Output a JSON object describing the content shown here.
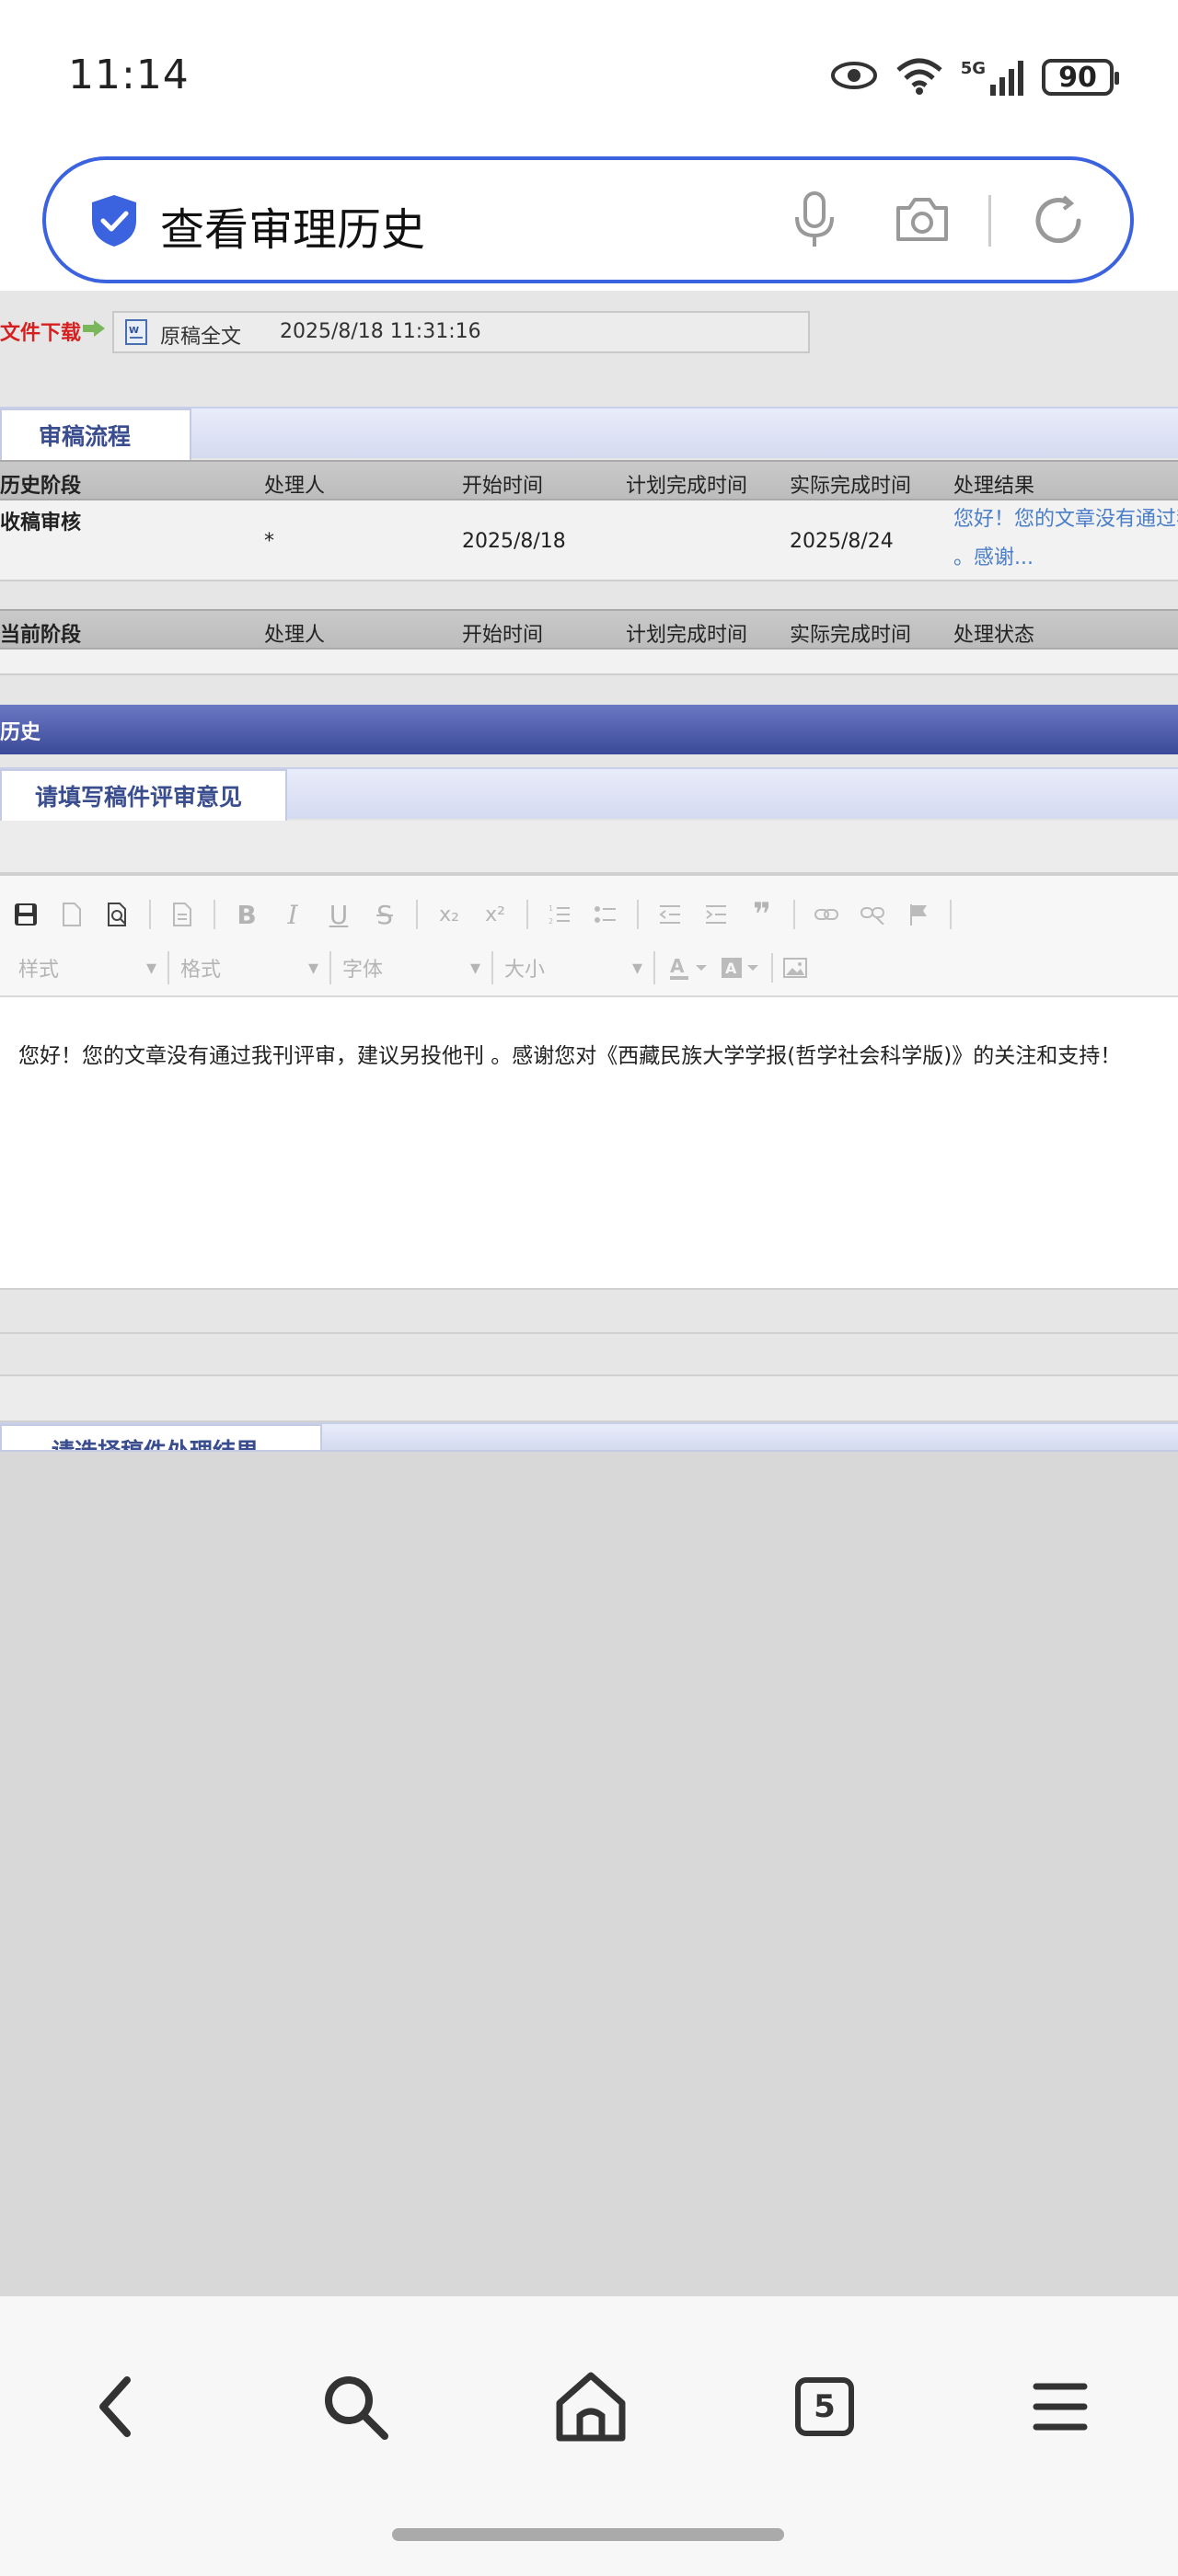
{
  "status_bar": {
    "time": "11:14",
    "battery": "90",
    "network": "5G"
  },
  "search": {
    "query": "查看审理历史"
  },
  "download": {
    "label": "文件下载",
    "file_name": "原稿全文",
    "date": "2025/8/18  11:31:16"
  },
  "review_process": {
    "tab_label": "审稿流程",
    "history_columns": [
      "历史阶段",
      "处理人",
      "开始时间",
      "计划完成时间",
      "实际完成时间",
      "处理结果"
    ],
    "history_rows": [
      {
        "stage": "收稿审核",
        "handler": "*",
        "start": "2025/8/18",
        "planned": "",
        "actual": "2025/8/24",
        "result_line1": "您好！您的文章没有通过我刊评审",
        "result_line2": "。感谢..."
      }
    ],
    "current_columns": [
      "当前阶段",
      "处理人",
      "开始时间",
      "计划完成时间",
      "实际完成时间",
      "处理状态"
    ]
  },
  "history_bar": {
    "label": "历史"
  },
  "comment_tab": {
    "label": "请填写稿件评审意见"
  },
  "editor": {
    "style_select": "样式",
    "format_select": "格式",
    "font_select": "字体",
    "size_select": "大小",
    "content": "您好！您的文章没有通过我刊评审，建议另投他刊 。感谢您对《西藏民族大学学报(哲学社会科学版)》的关注和支持！"
  },
  "result_tab": {
    "label": "请选择稿件处理结果"
  },
  "nav": {
    "tabs_count": "5"
  },
  "colors": {
    "accent": "#3b63e0",
    "tab_text": "#3a4d8f",
    "link": "#4a7ec8",
    "download_label": "#d62020"
  }
}
